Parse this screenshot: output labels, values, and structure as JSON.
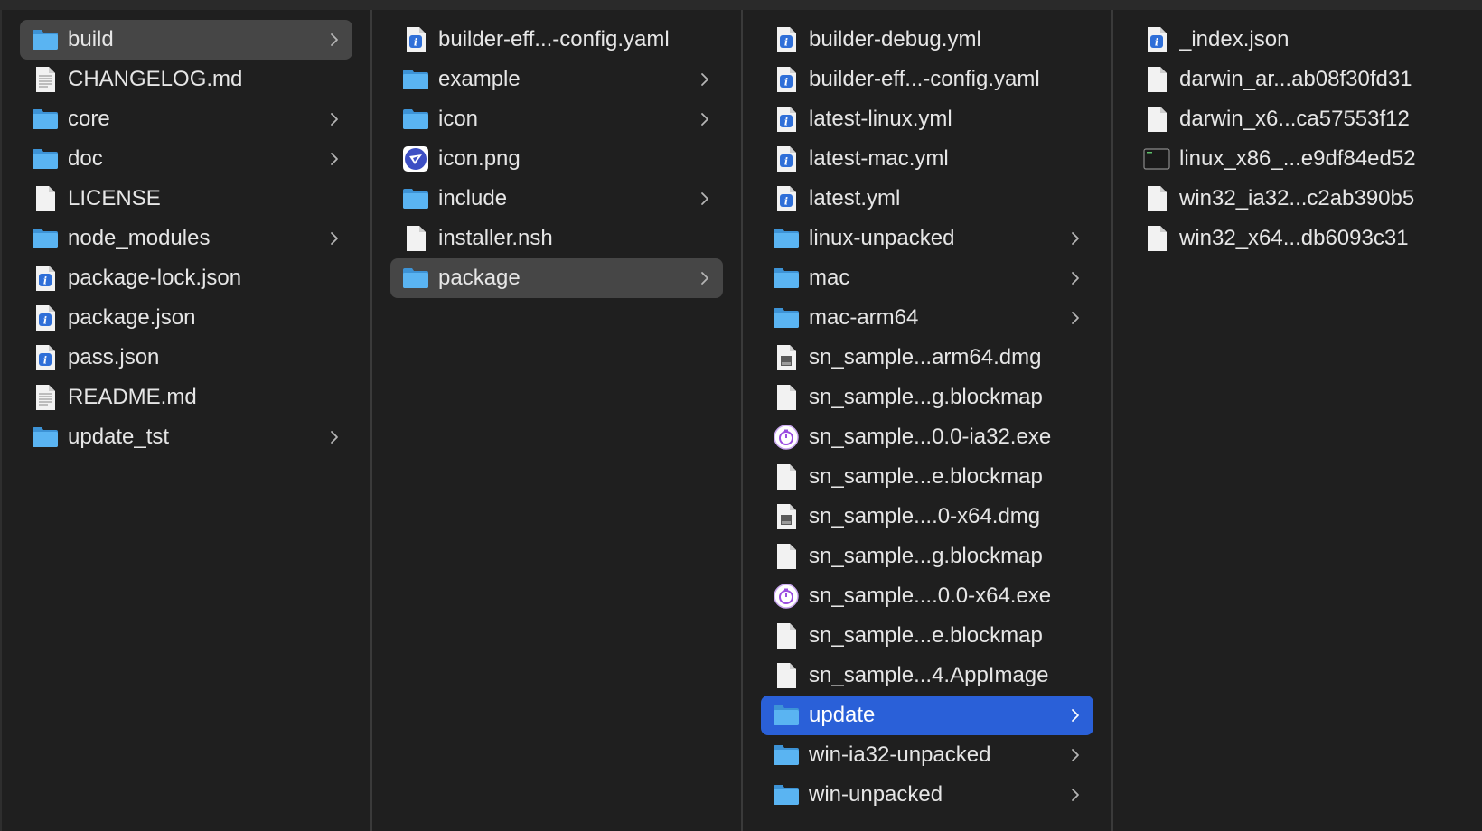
{
  "columns": [
    {
      "items": [
        {
          "label": "build",
          "icon": "folder-icon",
          "chevron": true,
          "selected": "gray"
        },
        {
          "label": "CHANGELOG.md",
          "icon": "text-document-icon",
          "chevron": false
        },
        {
          "label": "core",
          "icon": "folder-icon",
          "chevron": true
        },
        {
          "label": "doc",
          "icon": "folder-icon",
          "chevron": true
        },
        {
          "label": "LICENSE",
          "icon": "document-icon",
          "chevron": false
        },
        {
          "label": "node_modules",
          "icon": "folder-icon",
          "chevron": true
        },
        {
          "label": "package-lock.json",
          "icon": "info-document-icon",
          "chevron": false
        },
        {
          "label": "package.json",
          "icon": "info-document-icon",
          "chevron": false
        },
        {
          "label": "pass.json",
          "icon": "info-document-icon",
          "chevron": false
        },
        {
          "label": "README.md",
          "icon": "text-document-icon",
          "chevron": false
        },
        {
          "label": "update_tst",
          "icon": "folder-icon",
          "chevron": true
        }
      ]
    },
    {
      "items": [
        {
          "label": "builder-eff...-config.yaml",
          "icon": "info-document-icon",
          "chevron": false
        },
        {
          "label": "example",
          "icon": "folder-icon",
          "chevron": true
        },
        {
          "label": "icon",
          "icon": "folder-icon",
          "chevron": true
        },
        {
          "label": "icon.png",
          "icon": "app-image-icon",
          "chevron": false
        },
        {
          "label": "include",
          "icon": "folder-icon",
          "chevron": true
        },
        {
          "label": "installer.nsh",
          "icon": "document-icon",
          "chevron": false
        },
        {
          "label": "package",
          "icon": "folder-icon",
          "chevron": true,
          "selected": "gray"
        }
      ]
    },
    {
      "items": [
        {
          "label": "builder-debug.yml",
          "icon": "info-document-icon",
          "chevron": false
        },
        {
          "label": "builder-eff...-config.yaml",
          "icon": "info-document-icon",
          "chevron": false
        },
        {
          "label": "latest-linux.yml",
          "icon": "info-document-icon",
          "chevron": false
        },
        {
          "label": "latest-mac.yml",
          "icon": "info-document-icon",
          "chevron": false
        },
        {
          "label": "latest.yml",
          "icon": "info-document-icon",
          "chevron": false
        },
        {
          "label": "linux-unpacked",
          "icon": "folder-icon",
          "chevron": true
        },
        {
          "label": "mac",
          "icon": "folder-icon",
          "chevron": true
        },
        {
          "label": "mac-arm64",
          "icon": "folder-icon",
          "chevron": true
        },
        {
          "label": "sn_sample...arm64.dmg",
          "icon": "disk-image-icon",
          "chevron": false
        },
        {
          "label": "sn_sample...g.blockmap",
          "icon": "document-icon",
          "chevron": false
        },
        {
          "label": "sn_sample...0.0-ia32.exe",
          "icon": "exe-icon",
          "chevron": false
        },
        {
          "label": "sn_sample...e.blockmap",
          "icon": "document-icon",
          "chevron": false
        },
        {
          "label": "sn_sample....0-x64.dmg",
          "icon": "disk-image-icon",
          "chevron": false
        },
        {
          "label": "sn_sample...g.blockmap",
          "icon": "document-icon",
          "chevron": false
        },
        {
          "label": "sn_sample....0.0-x64.exe",
          "icon": "exe-icon",
          "chevron": false
        },
        {
          "label": "sn_sample...e.blockmap",
          "icon": "document-icon",
          "chevron": false
        },
        {
          "label": "sn_sample...4.AppImage",
          "icon": "document-icon",
          "chevron": false
        },
        {
          "label": "update",
          "icon": "folder-icon",
          "chevron": true,
          "selected": "blue"
        },
        {
          "label": "win-ia32-unpacked",
          "icon": "folder-icon",
          "chevron": true
        },
        {
          "label": "win-unpacked",
          "icon": "folder-icon",
          "chevron": true
        }
      ]
    },
    {
      "items": [
        {
          "label": "_index.json",
          "icon": "info-document-icon",
          "chevron": false
        },
        {
          "label": "darwin_ar...ab08f30fd31",
          "icon": "document-icon",
          "chevron": false
        },
        {
          "label": "darwin_x6...ca57553f12",
          "icon": "document-icon",
          "chevron": false
        },
        {
          "label": "linux_x86_...e9df84ed52",
          "icon": "terminal-icon",
          "chevron": false
        },
        {
          "label": "win32_ia32...c2ab390b5",
          "icon": "document-icon",
          "chevron": false
        },
        {
          "label": "win32_x64...db6093c31",
          "icon": "document-icon",
          "chevron": false
        }
      ]
    }
  ],
  "colors": {
    "background": "#1f1f1f",
    "selected_gray": "#464646",
    "selected_blue": "#2a60d8",
    "folder": "#4aa6ea",
    "text": "#e6e6e6"
  }
}
